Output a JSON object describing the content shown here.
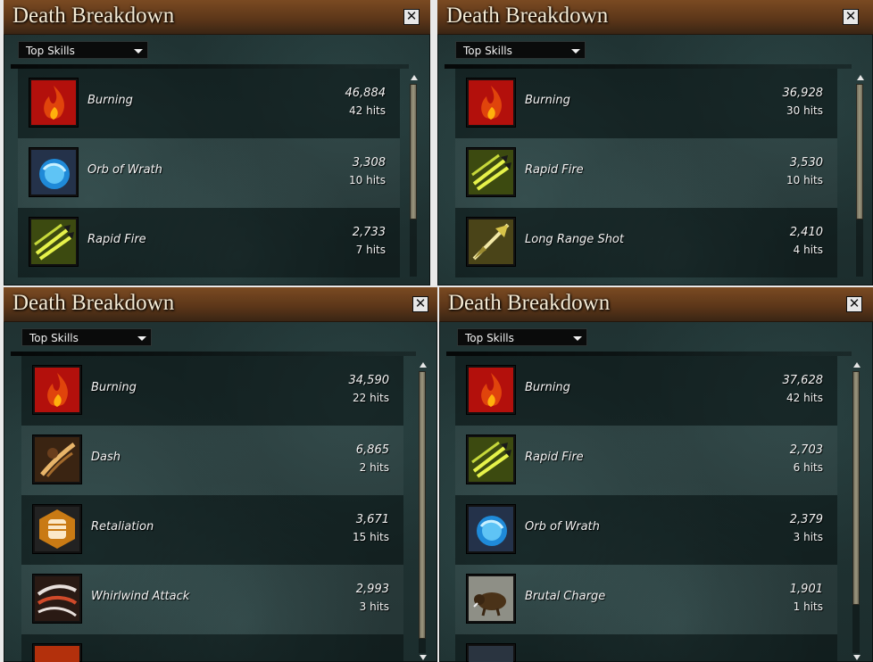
{
  "panels": [
    {
      "title": "Death Breakdown",
      "dropdown": "Top Skills",
      "skills": [
        {
          "name": "Burning",
          "damage": "46,884",
          "hits": "42 hits",
          "icon": "fire-icon"
        },
        {
          "name": "Orb of Wrath",
          "damage": "3,308",
          "hits": "10 hits",
          "icon": "blue-orb-icon"
        },
        {
          "name": "Rapid Fire",
          "damage": "2,733",
          "hits": "7 hits",
          "icon": "arrows-icon"
        }
      ]
    },
    {
      "title": "Death Breakdown",
      "dropdown": "Top Skills",
      "skills": [
        {
          "name": "Burning",
          "damage": "36,928",
          "hits": "30 hits",
          "icon": "fire-icon"
        },
        {
          "name": "Rapid Fire",
          "damage": "3,530",
          "hits": "10 hits",
          "icon": "arrows-icon"
        },
        {
          "name": "Long Range Shot",
          "damage": "2,410",
          "hits": "4 hits",
          "icon": "long-arrow-icon"
        }
      ]
    },
    {
      "title": "Death Breakdown",
      "dropdown": "Top Skills",
      "skills": [
        {
          "name": "Burning",
          "damage": "34,590",
          "hits": "22 hits",
          "icon": "fire-icon"
        },
        {
          "name": "Dash",
          "damage": "6,865",
          "hits": "2 hits",
          "icon": "dash-icon"
        },
        {
          "name": "Retaliation",
          "damage": "3,671",
          "hits": "15 hits",
          "icon": "fist-icon"
        },
        {
          "name": "Whirlwind Attack",
          "damage": "2,993",
          "hits": "3 hits",
          "icon": "whirlwind-icon"
        }
      ]
    },
    {
      "title": "Death Breakdown",
      "dropdown": "Top Skills",
      "skills": [
        {
          "name": "Burning",
          "damage": "37,628",
          "hits": "42 hits",
          "icon": "fire-icon"
        },
        {
          "name": "Rapid Fire",
          "damage": "2,703",
          "hits": "6 hits",
          "icon": "arrows-icon"
        },
        {
          "name": "Orb of Wrath",
          "damage": "2,379",
          "hits": "3 hits",
          "icon": "blue-orb-icon"
        },
        {
          "name": "Brutal Charge",
          "damage": "1,901",
          "hits": "1 hits",
          "icon": "boar-icon"
        }
      ]
    }
  ]
}
